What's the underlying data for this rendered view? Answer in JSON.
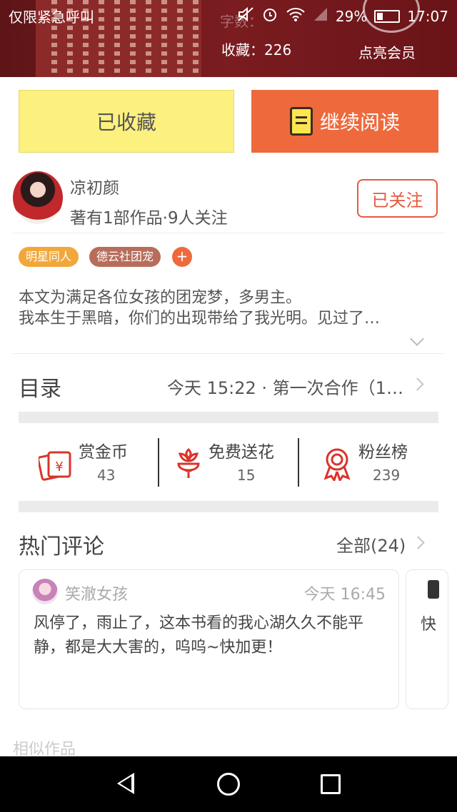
{
  "status_bar": {
    "carrier_text": "仅限紧急呼叫",
    "battery_percent": "29%",
    "time": "17:07"
  },
  "header": {
    "ghost_text": "字数：",
    "favorites_count": "收藏：226",
    "vip_link": "点亮会员"
  },
  "actions": {
    "favorited_label": "已收藏",
    "continue_label": "继续阅读"
  },
  "author": {
    "name": "凉初颜",
    "meta": "著有1部作品·9人关注",
    "follow_label": "已关注"
  },
  "tags": [
    {
      "label": "明星同人",
      "color": "#f2a73b"
    },
    {
      "label": "德云社团宠",
      "color": "#b76d5a"
    }
  ],
  "tag_add": "+",
  "description": {
    "line1": "本文为满足各位女孩的团宠梦，多男主。",
    "line2": "我本生于黑暗，你们的出现带给了我光明。见过了…"
  },
  "catalog": {
    "title": "目录",
    "latest": "今天 15:22 · 第一次合作（1…"
  },
  "stats": [
    {
      "label": "赏金币",
      "value": "43",
      "icon": "reward-coin-icon",
      "color": "#d9342b"
    },
    {
      "label": "免费送花",
      "value": "15",
      "icon": "flower-icon",
      "color": "#d9342b"
    },
    {
      "label": "粉丝榜",
      "value": "239",
      "icon": "fan-badge-icon",
      "color": "#d9342b"
    }
  ],
  "hot_comments": {
    "title": "热门评论",
    "all_label": "全部(24)",
    "comments": [
      {
        "user": "笑澈女孩",
        "time": "今天 16:45",
        "text": "风停了，雨止了，这本书看的我心湖久久不能平静，都是大大害的，呜呜~快加更！"
      },
      {
        "text": "快"
      }
    ]
  },
  "similar_title": "相似作品"
}
